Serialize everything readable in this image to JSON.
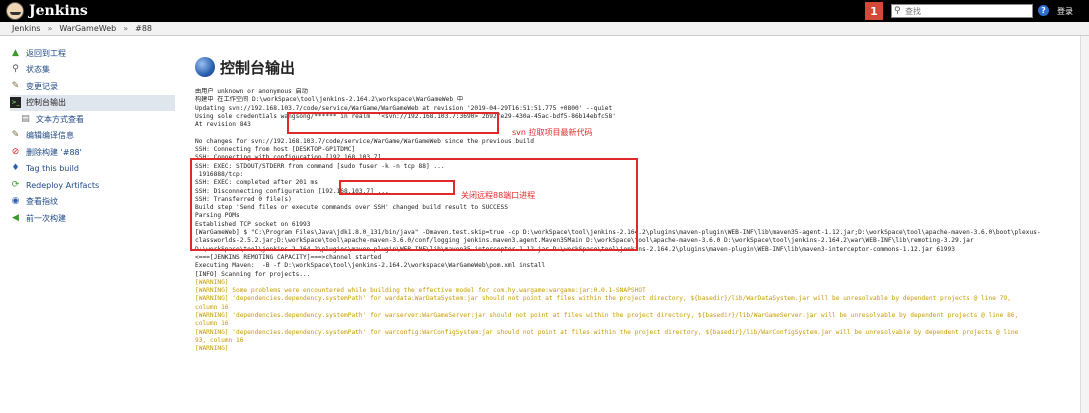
{
  "header": {
    "logo_text": "Jenkins",
    "notification_count": "1",
    "search_placeholder": "查找",
    "login_label": "登录"
  },
  "breadcrumb": [
    "Jenkins",
    "WarGameWeb",
    "#88"
  ],
  "sidebar": {
    "items": [
      {
        "label": "返回到工程",
        "icon": "up-arrow-icon"
      },
      {
        "label": "状态集",
        "icon": "magnifier-icon"
      },
      {
        "label": "变更记录",
        "icon": "notepad-icon"
      },
      {
        "label": "控制台输出",
        "icon": "terminal-icon"
      },
      {
        "label": "文本方式查看",
        "icon": "document-icon"
      },
      {
        "label": "编辑编译信息",
        "icon": "notepad-icon"
      },
      {
        "label": "删除构建 '#88'",
        "icon": "no-entry-icon"
      },
      {
        "label": "Tag this build",
        "icon": "tag-icon"
      },
      {
        "label": "Redeploy Artifacts",
        "icon": "redeploy-icon"
      },
      {
        "label": "查看指纹",
        "icon": "fingerprint-icon"
      },
      {
        "label": "前一次构建",
        "icon": "left-arrow-icon"
      }
    ]
  },
  "page_title": "控制台输出",
  "console": {
    "lines": [
      {
        "text": "由用户 unknown or anonymous 启动",
        "warn": false
      },
      {
        "text": "构建中 在工作空间 D:\\workSpace\\tool\\jenkins-2.164.2\\workspace\\WarGameWeb 中",
        "warn": false
      },
      {
        "text": "Updating svn://192.168.103.7/code/service/WarGame/WarGameWeb at revision '2019-04-29T16:51:51.775 +0800' --quiet",
        "warn": false
      },
      {
        "text": "Using sole credentials wangsong/****** in realm  '<svn://192.168.103.7:3690> 2b92fe29-430a-45ac-bdf5-86b14ebfc58'",
        "warn": false
      },
      {
        "text": "At revision 843",
        "warn": false
      },
      {
        "text": "",
        "warn": false
      },
      {
        "text": "No changes for svn://192.168.103.7/code/service/WarGame/WarGameWeb since the previous build",
        "warn": false
      },
      {
        "text": "SSH: Connecting from host [DESKTOP-GP1TDMC]",
        "warn": false
      },
      {
        "text": "SSH: Connecting with configuration [192.168.103.7] ...",
        "warn": false
      },
      {
        "text": "SSH: EXEC: STDOUT/STDERR from command [sudo fuser -k -n tcp 88] ...",
        "warn": false
      },
      {
        "text": " 1916888/tcp:",
        "warn": false
      },
      {
        "text": "SSH: EXEC: completed after 201 ms",
        "warn": false
      },
      {
        "text": "SSH: Disconnecting configuration [192.168.103.7] ...",
        "warn": false
      },
      {
        "text": "SSH: Transferred 0 file(s)",
        "warn": false
      },
      {
        "text": "Build step 'Send files or execute commands over SSH' changed build result to SUCCESS",
        "warn": false
      },
      {
        "text": "Parsing POMs",
        "warn": false
      },
      {
        "text": "Established TCP socket on 61993",
        "warn": false
      },
      {
        "text": "[WarGameWeb] $ \"C:\\Program Files\\Java\\jdk1.8.0_131/bin/java\" -Dmaven.test.skip=true -cp D:\\workSpace\\tool\\jenkins-2.164.2\\plugins\\maven-plugin\\WEB-INF\\lib\\maven35-agent-1.12.jar;D:\\workSpace\\tool\\apache-maven-3.6.0\\boot\\plexus-",
        "warn": false
      },
      {
        "text": "classworlds-2.5.2.jar;D:\\workSpace\\tool\\apache-maven-3.6.0/conf/logging jenkins.maven3.agent.Maven35Main D:\\workSpace\\tool\\apache-maven-3.6.0 D:\\workSpace\\tool\\jenkins-2.164.2\\war\\WEB-INF\\lib\\remoting-3.29.jar",
        "warn": false
      },
      {
        "text": "D:\\workSpace\\tool\\jenkins-2.164.2\\plugins\\maven-plugin\\WEB-INF\\lib\\maven35-interceptor-1.12.jar D:\\workSpace\\tool\\jenkins-2.164.2\\plugins\\maven-plugin\\WEB-INF\\lib\\maven3-interceptor-commons-1.12.jar 61993",
        "warn": false
      },
      {
        "text": "<===[JENKINS REMOTING CAPACITY]===>channel started",
        "warn": false
      },
      {
        "text": "Executing Maven:  -B -f D:\\workSpace\\tool\\jenkins-2.164.2\\workspace\\WarGameWeb\\pom.xml install",
        "warn": false
      },
      {
        "text": "[INFO] Scanning for projects...",
        "warn": false
      },
      {
        "text": "[WARNING]",
        "warn": true
      },
      {
        "text": "[WARNING] Some problems were encountered while building the effective model for com.hy.wargame:wargame:jar:0.0.1-SNAPSHOT",
        "warn": true
      },
      {
        "text": "[WARNING] 'dependencies.dependency.systemPath' for wardata:WarDataSystem:jar should not point at files within the project directory, ${basedir}/lib/WarDataSystem.jar will be unresolvable by dependent projects @ line 79,",
        "warn": true
      },
      {
        "text": "column 16",
        "warn": true
      },
      {
        "text": "[WARNING] 'dependencies.dependency.systemPath' for warserver:WarGameServer:jar should not point at files within the project directory, ${basedir}/lib/WarGameServer.jar will be unresolvable by dependent projects @ line 86,",
        "warn": true
      },
      {
        "text": "column 16",
        "warn": true
      },
      {
        "text": "[WARNING] 'dependencies.dependency.systemPath' for warconfig:WarConfigSystem:jar should not point at files within the project directory, ${basedir}/lib/WarConfigSystem.jar will be unresolvable by dependent projects @ line",
        "warn": true
      },
      {
        "text": "93, column 16",
        "warn": true
      },
      {
        "text": "[WARNING]",
        "warn": true
      }
    ]
  },
  "annotations": {
    "svn_note": "svn 拉取项目最新代码",
    "ssh_note": "关闭远程88端口进程"
  },
  "colors": {
    "topbar": "#000000",
    "notification": "#d24939",
    "link": "#204a87",
    "warning": "#c89b00",
    "annotation": "#e02a2a"
  }
}
